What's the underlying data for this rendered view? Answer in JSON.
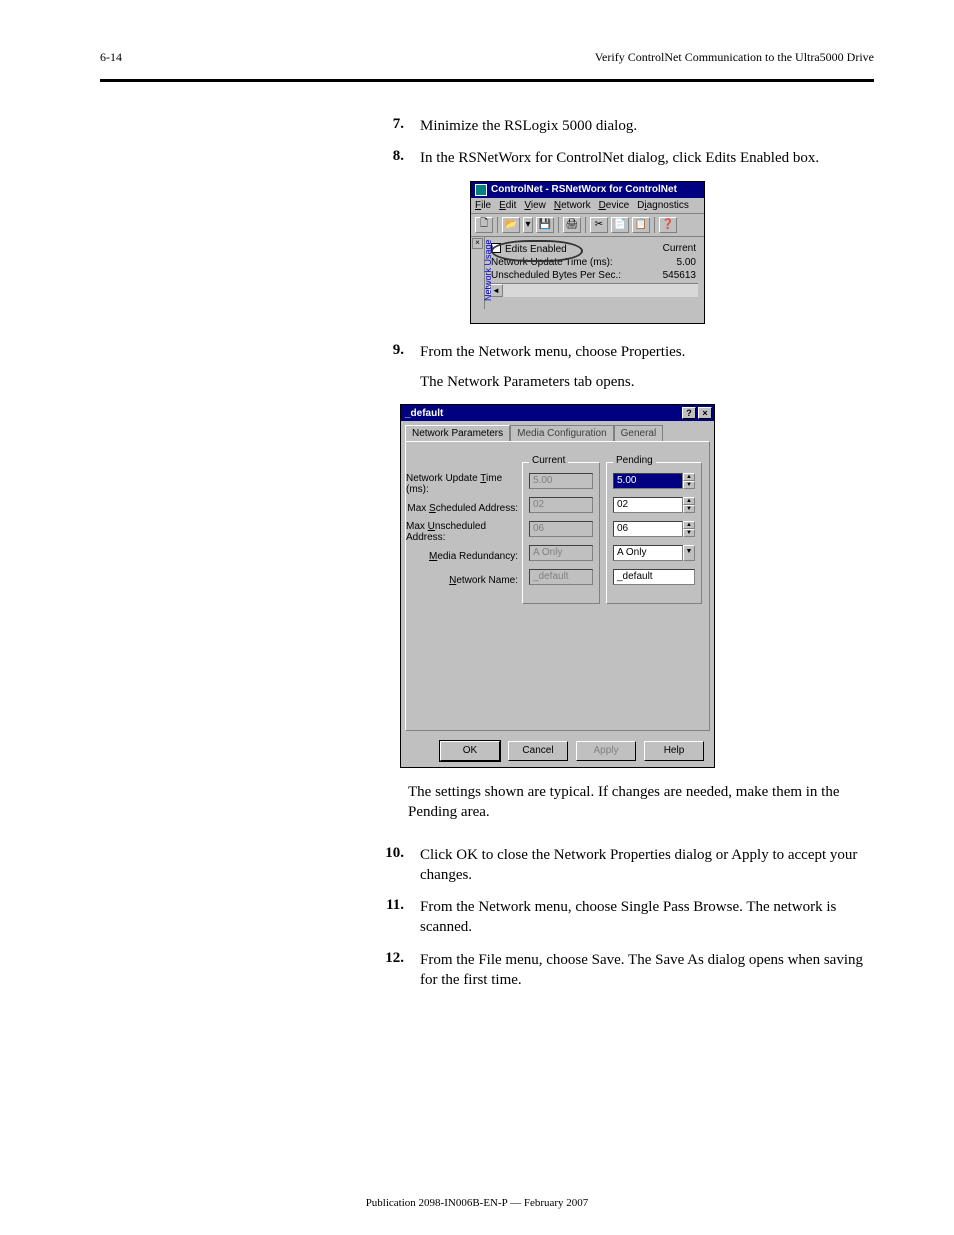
{
  "header": {
    "left": "6-14",
    "right": "Verify ControlNet Communication to the Ultra5000 Drive"
  },
  "steps": {
    "s7": "Minimize the RSLogix 5000 dialog.",
    "s8": "In the RSNetWorx for ControlNet dialog, click Edits Enabled box.",
    "s9": {
      "text_a": "From the Network menu, choose Properties.",
      "text_b": "The Network Parameters tab opens."
    },
    "below_dialog": "The settings shown are typical. If changes are needed, make them in the Pending area.",
    "s10": "Click OK to close the Network Properties dialog or Apply to accept your changes.",
    "s11": "From the Network menu, choose Single Pass Browse. The network is scanned.",
    "s12": "From the File menu, choose Save. The Save As dialog opens when saving for the first time."
  },
  "rsn": {
    "title": "ControlNet - RSNetWorx for ControlNet",
    "menu": {
      "file": "File",
      "edit": "Edit",
      "view": "View",
      "network": "Network",
      "device": "Device",
      "diagnostics": "Diagnostics"
    },
    "toolbar": {
      "new": "🗋",
      "open": "📂",
      "down": "▾",
      "save": "💾",
      "print": "🖨",
      "cut": "✂",
      "copy": "📄",
      "paste": "📋",
      "help": "❓"
    },
    "side_tab": "Network Usage",
    "body": {
      "edits_enabled": "Edits Enabled",
      "nut_label": "Network Update Time (ms):",
      "nut_val_header": "Current",
      "nut_val": "5.00",
      "unsched_label": "Unscheduled Bytes Per Sec.:",
      "unsched_val": "545613"
    }
  },
  "dlg": {
    "title": "_default",
    "tabs": {
      "np": "Network Parameters",
      "mc": "Media Configuration",
      "gen": "General"
    },
    "groups": {
      "current": "Current",
      "pending": "Pending"
    },
    "rows": {
      "nut": {
        "label_pre": "Network Update ",
        "label_u": "T",
        "label_post": "ime (ms):",
        "cur": "5.00",
        "pend": "5.00"
      },
      "msa": {
        "label_pre": "Max ",
        "label_u": "S",
        "label_post": "cheduled Address:",
        "cur": "02",
        "pend": "02"
      },
      "mua": {
        "label_pre": "Max ",
        "label_u": "U",
        "label_post": "nscheduled Address:",
        "cur": "06",
        "pend": "06"
      },
      "med": {
        "label_u": "M",
        "label_post": "edia Redundancy:",
        "cur": "A Only",
        "pend": "A Only"
      },
      "name": {
        "label_u": "N",
        "label_post": "etwork Name:",
        "cur": "_default",
        "pend": "_default"
      }
    },
    "btns": {
      "ok": "OK",
      "cancel": "Cancel",
      "apply": "Apply",
      "help": "Help"
    }
  },
  "pubno": "Publication 2098-IN006B-EN-P — February 2007"
}
